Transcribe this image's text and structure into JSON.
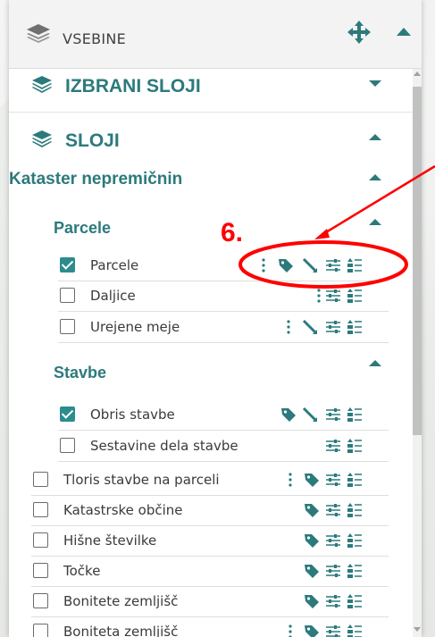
{
  "panel": {
    "header_title": "VSEBINE",
    "icons": [
      "layers-icon",
      "move-icon",
      "collapse-up-icon"
    ]
  },
  "sections": {
    "izbrani_sloji": "IZBRANI SLOJI",
    "sloji": "SLOJI"
  },
  "kataster": {
    "title": "Kataster nepremičnin",
    "parcele": {
      "title": "Parcele",
      "items": [
        {
          "label": "Parcele",
          "checked": true
        },
        {
          "label": "Daljice",
          "checked": false
        },
        {
          "label": "Urejene meje",
          "checked": false
        }
      ]
    },
    "stavbe": {
      "title": "Stavbe",
      "items": [
        {
          "label": "Obris stavbe",
          "checked": true
        },
        {
          "label": "Sestavine dela stavbe",
          "checked": false
        }
      ]
    },
    "items": [
      {
        "label": "Tloris stavbe na parceli",
        "checked": false
      },
      {
        "label": "Katastrske občine",
        "checked": false
      },
      {
        "label": "Hišne številke",
        "checked": false
      },
      {
        "label": "Točke",
        "checked": false
      },
      {
        "label": "Bonitete zemljišč",
        "checked": false
      },
      {
        "label": "Boniteta zemljišč",
        "checked": false
      }
    ]
  },
  "annotation": {
    "number": "6.",
    "color": "#ff0000"
  },
  "colors": {
    "accent": "#2c7a7c",
    "checkbox_checked": "#2c8c8e"
  }
}
